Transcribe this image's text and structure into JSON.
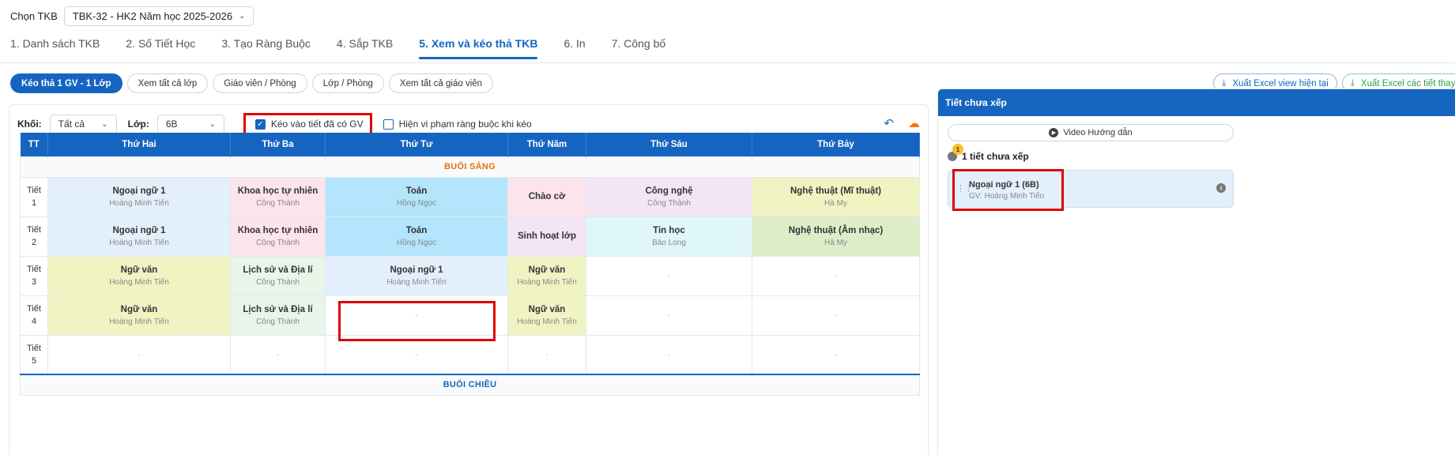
{
  "header": {
    "select_label": "Chọn TKB",
    "select_value": "TBK-32 - HK2 Năm học 2025-2026"
  },
  "steps": [
    {
      "label": "1. Danh sách TKB"
    },
    {
      "label": "2. Số Tiết Học"
    },
    {
      "label": "3. Tạo Ràng Buộc"
    },
    {
      "label": "4. Sắp TKB"
    },
    {
      "label": "5. Xem và kéo thả TKB"
    },
    {
      "label": "6. In"
    },
    {
      "label": "7. Công bố"
    }
  ],
  "active_step": "5. Xem và kéo thả TKB",
  "view_modes": [
    {
      "label": "Kéo thả 1 GV - 1 Lớp"
    },
    {
      "label": "Xem tất cả lớp"
    },
    {
      "label": "Giáo viên / Phòng"
    },
    {
      "label": "Lớp / Phòng"
    },
    {
      "label": "Xem tất cả giáo viên"
    }
  ],
  "exports": {
    "current": "Xuất Excel view hiện tại",
    "changed": "Xuất Excel các tiết thay đổi"
  },
  "filters": {
    "khoi_label": "Khối:",
    "khoi_value": "Tất cả",
    "lop_label": "Lớp:",
    "lop_value": "6B",
    "drag_into_label": "Kéo vào tiết đã có GV",
    "drag_into_checked": true,
    "show_violation_label": "Hiện vi phạm ràng buộc khi kéo",
    "show_violation_checked": false
  },
  "table": {
    "columns": [
      "TT",
      "Thứ Hai",
      "Thứ Ba",
      "Thứ Tư",
      "Thứ Năm",
      "Thứ Sáu",
      "Thứ Bảy"
    ],
    "morning_label": "BUỔI SÁNG",
    "afternoon_label": "BUỔI CHIỀU",
    "tiet_word": "Tiết",
    "empty_mark": "-",
    "rows": [
      {
        "num": "1",
        "cells": [
          {
            "subject": "Ngoại ngữ 1",
            "teacher": "Hoàng Minh Tiến"
          },
          {
            "subject": "Khoa học tự nhiên",
            "teacher": "Công Thành"
          },
          {
            "subject": "Toán",
            "teacher": "Hồng Ngọc"
          },
          {
            "subject": "Chào cờ",
            "teacher": ""
          },
          {
            "subject": "Công nghệ",
            "teacher": "Công Thành"
          },
          {
            "subject": "Nghệ thuật (Mĩ thuật)",
            "teacher": "Hà My"
          }
        ]
      },
      {
        "num": "2",
        "cells": [
          {
            "subject": "Ngoại ngữ 1",
            "teacher": "Hoàng Minh Tiến"
          },
          {
            "subject": "Khoa học tự nhiên",
            "teacher": "Công Thành"
          },
          {
            "subject": "Toán",
            "teacher": "Hồng Ngọc"
          },
          {
            "subject": "Sinh hoạt lớp",
            "teacher": ""
          },
          {
            "subject": "Tin học",
            "teacher": "Bảo Long"
          },
          {
            "subject": "Nghệ thuật (Âm nhạc)",
            "teacher": "Hà My"
          }
        ]
      },
      {
        "num": "3",
        "cells": [
          {
            "subject": "Ngữ văn",
            "teacher": "Hoàng Minh Tiến"
          },
          {
            "subject": "Lịch sử và Địa lí",
            "teacher": "Công Thành"
          },
          {
            "subject": "Ngoại ngữ 1",
            "teacher": "Hoàng Minh Tiến"
          },
          {
            "subject": "Ngữ văn",
            "teacher": "Hoàng Minh Tiến"
          },
          {
            "subject": "",
            "teacher": ""
          },
          {
            "subject": "",
            "teacher": ""
          }
        ]
      },
      {
        "num": "4",
        "cells": [
          {
            "subject": "Ngữ văn",
            "teacher": "Hoàng Minh Tiến"
          },
          {
            "subject": "Lịch sử và Địa lí",
            "teacher": "Công Thành"
          },
          {
            "subject": "",
            "teacher": ""
          },
          {
            "subject": "Ngữ văn",
            "teacher": "Hoàng Minh Tiến"
          },
          {
            "subject": "",
            "teacher": ""
          },
          {
            "subject": "",
            "teacher": ""
          }
        ]
      },
      {
        "num": "5",
        "cells": [
          {
            "subject": "",
            "teacher": ""
          },
          {
            "subject": "",
            "teacher": ""
          },
          {
            "subject": "",
            "teacher": ""
          },
          {
            "subject": "",
            "teacher": ""
          },
          {
            "subject": "",
            "teacher": ""
          },
          {
            "subject": "",
            "teacher": ""
          }
        ]
      }
    ]
  },
  "side": {
    "title": "Tiết chưa xếp",
    "video_label": "Video Hướng dẫn",
    "badge_count": "1",
    "count_label": "1 tiết chưa xếp",
    "pending": [
      {
        "title": "Ngoại ngữ 1 (6B)",
        "teacher": "GV: Hoàng Minh Tiến"
      }
    ]
  },
  "colors": {
    "primary": "#1565c0",
    "highlight": "#e00000",
    "morning": "#e8710a",
    "export_green": "#2e9d4b"
  }
}
